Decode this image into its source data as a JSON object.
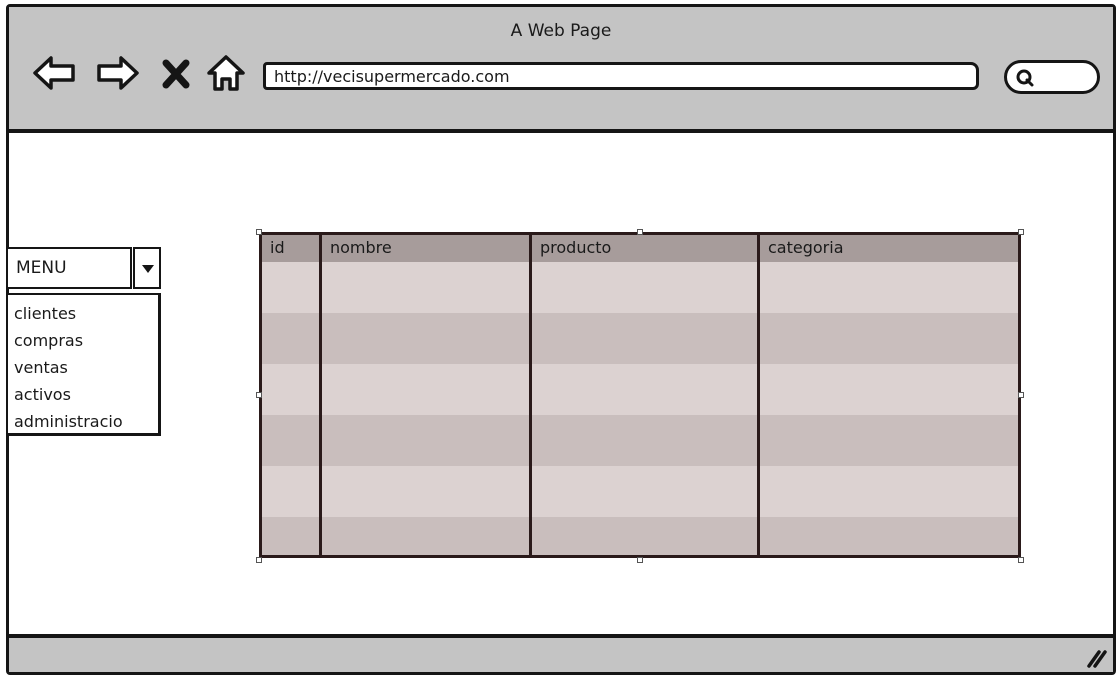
{
  "browser": {
    "title": "A Web Page",
    "url": "http://vecisupermercado.com",
    "nav_icons": [
      "back-arrow-icon",
      "forward-arrow-icon",
      "close-icon",
      "home-icon"
    ],
    "search_icon": "search-icon"
  },
  "menu": {
    "label": "MENU",
    "items": [
      "clientes",
      "compras",
      "ventas",
      "activos",
      "administracio"
    ]
  },
  "table": {
    "columns": [
      "id",
      "nombre",
      "producto",
      "categoria"
    ],
    "row_count": 6
  },
  "colors": {
    "chrome": "#c4c4c4",
    "table_header": "#a79c9b",
    "table_row_dark": "#c9bebd",
    "table_row_light": "#dcd2d1",
    "border": "#151515"
  }
}
